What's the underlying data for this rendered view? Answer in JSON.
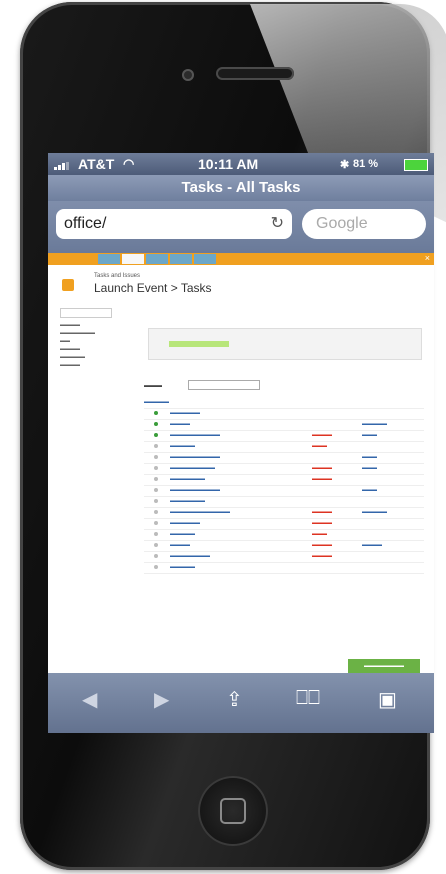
{
  "status": {
    "carrier": "AT&T",
    "time": "10:11 AM",
    "battery": "81 %"
  },
  "browser": {
    "title": "Tasks - All Tasks",
    "url": "office/",
    "search_placeholder": "Google"
  },
  "app": {
    "parent": "Tasks and Issues",
    "title": "Launch Event > Tasks"
  },
  "colors": {
    "accent": "#f0a020",
    "green": "#6bb245",
    "nav": "#6f7f9e"
  }
}
